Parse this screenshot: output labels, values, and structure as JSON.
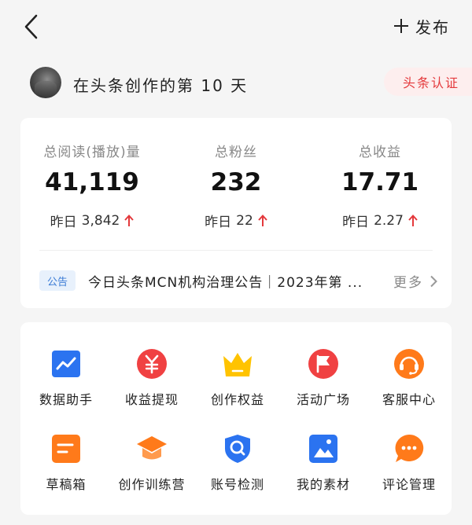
{
  "header": {
    "publish_label": "发布"
  },
  "creator": {
    "days_text": "在头条创作的第 10 天",
    "cert_label": "头条认证"
  },
  "stats": [
    {
      "label": "总阅读(播放)量",
      "value": "41,119",
      "yesterday_label": "昨日",
      "yesterday_value": "3,842",
      "trend": "up"
    },
    {
      "label": "总粉丝",
      "value": "232",
      "yesterday_label": "昨日",
      "yesterday_value": "22",
      "trend": "up"
    },
    {
      "label": "总收益",
      "value": "17.71",
      "yesterday_label": "昨日",
      "yesterday_value": "2.27",
      "trend": "up"
    }
  ],
  "notice": {
    "tag": "公告",
    "text": "今日头条MCN机构治理公告｜2023年第 ...",
    "more_label": "更多"
  },
  "tools": [
    {
      "label": "数据助手",
      "icon": "data-chart-icon",
      "color": "#2b73f0"
    },
    {
      "label": "收益提现",
      "icon": "yuan-icon",
      "color": "#f04142"
    },
    {
      "label": "创作权益",
      "icon": "crown-icon",
      "color": "#ffc300"
    },
    {
      "label": "活动广场",
      "icon": "flag-icon",
      "color": "#f04142"
    },
    {
      "label": "客服中心",
      "icon": "headset-icon",
      "color": "#ff7a1a"
    },
    {
      "label": "草稿箱",
      "icon": "draft-icon",
      "color": "#ff7a1a"
    },
    {
      "label": "创作训练营",
      "icon": "graduation-cap-icon",
      "color": "#ff7a1a"
    },
    {
      "label": "账号检测",
      "icon": "search-shield-icon",
      "color": "#2b73f0"
    },
    {
      "label": "我的素材",
      "icon": "image-icon",
      "color": "#2b73f0"
    },
    {
      "label": "评论管理",
      "icon": "comment-icon",
      "color": "#ff7a1a"
    }
  ],
  "colors": {
    "accent_red": "#e4393c",
    "accent_blue": "#3a7bd5"
  }
}
